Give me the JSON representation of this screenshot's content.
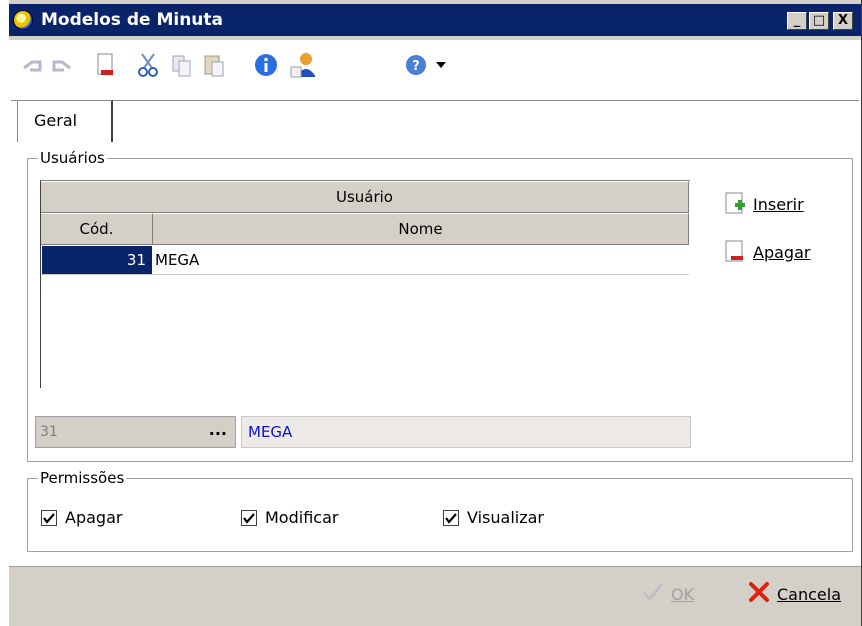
{
  "window": {
    "title": "Modelos de Minuta",
    "controls": {
      "minimize": "_",
      "maximize": "□",
      "close": "X"
    },
    "accent_color": "#0a246a"
  },
  "toolbar": {
    "icons": [
      "undo-icon",
      "redo-icon",
      "new-document-icon",
      "cut-icon",
      "copy-icon",
      "paste-icon",
      "info-icon",
      "user-properties-icon",
      "help-icon",
      "dropdown-arrow-icon"
    ]
  },
  "tabs": [
    {
      "label": "Geral",
      "active": true
    }
  ],
  "usuarios_group": {
    "legend": "Usuários",
    "grid": {
      "group_header": "Usuário",
      "columns": [
        "Cód.",
        "Nome"
      ],
      "rows": [
        {
          "code": "31",
          "name": "MEGA",
          "selected": true
        }
      ]
    },
    "lookup": {
      "code_value": "31",
      "ellipsis": "...",
      "name_value": "MEGA"
    },
    "buttons": {
      "insert": "Inserir",
      "delete": "Apagar"
    }
  },
  "permissoes_group": {
    "legend": "Permissões",
    "checkboxes": [
      {
        "label": "Apagar",
        "checked": true
      },
      {
        "label": "Modificar",
        "checked": true
      },
      {
        "label": "Visualizar",
        "checked": true
      }
    ]
  },
  "footer": {
    "ok": "OK",
    "cancel": "Cancela"
  }
}
